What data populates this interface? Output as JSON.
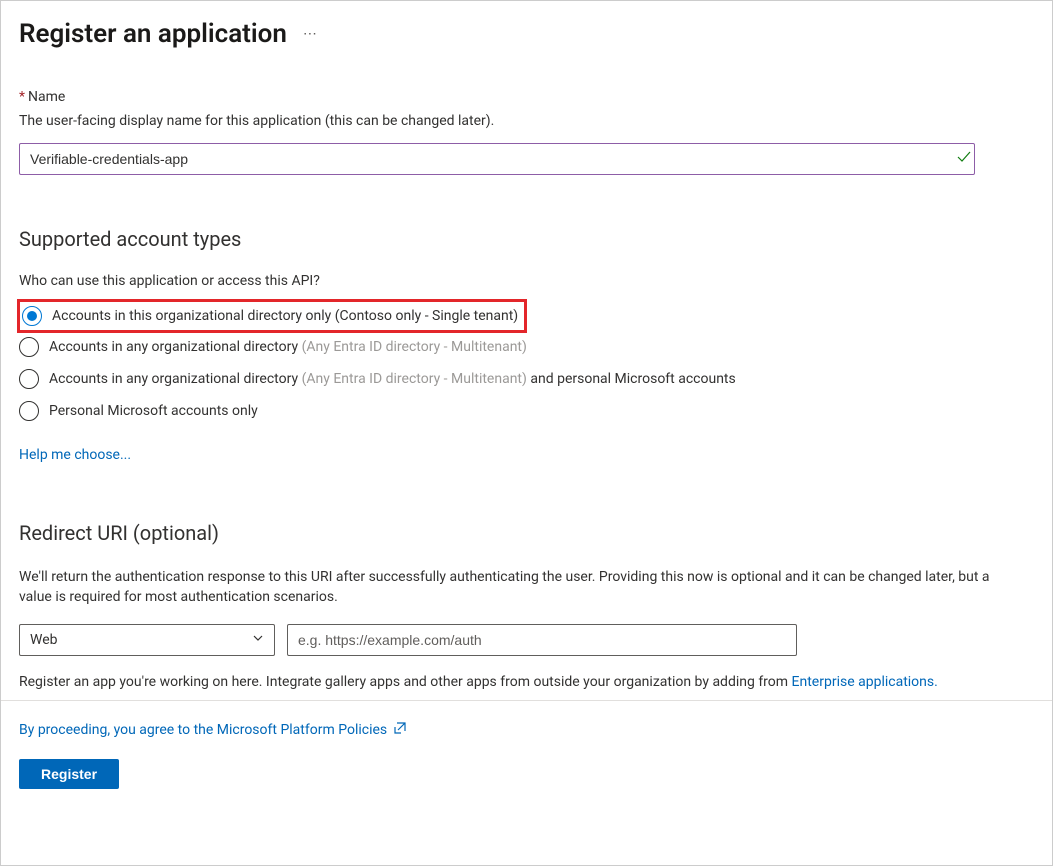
{
  "header": {
    "title": "Register an application"
  },
  "name_section": {
    "label": "Name",
    "description": "The user-facing display name for this application (this can be changed later).",
    "value": "Verifiable-credentials-app"
  },
  "account_types": {
    "title": "Supported account types",
    "question": "Who can use this application or access this API?",
    "options": [
      {
        "label": "Accounts in this organizational directory only (Contoso only - Single tenant)",
        "selected": true,
        "grey_suffix": ""
      },
      {
        "label": "Accounts in any organizational directory ",
        "grey_suffix": "(Any Entra ID directory - Multitenant)",
        "selected": false
      },
      {
        "label": "Accounts in any organizational directory ",
        "grey_suffix": "(Any Entra ID directory - Multitenant)",
        "extra_suffix": " and personal Microsoft accounts",
        "selected": false
      },
      {
        "label": "Personal Microsoft accounts only",
        "grey_suffix": "",
        "selected": false
      }
    ],
    "help_link": "Help me choose..."
  },
  "redirect": {
    "title": "Redirect URI (optional)",
    "description": "We'll return the authentication response to this URI after successfully authenticating the user. Providing this now is optional and it can be changed later, but a value is required for most authentication scenarios.",
    "platform_selected": "Web",
    "uri_placeholder": "e.g. https://example.com/auth"
  },
  "integrate_text": {
    "prefix": "Register an app you're working on here. Integrate gallery apps and other apps from outside your organization by adding from ",
    "link": "Enterprise applications."
  },
  "policies": {
    "text": "By proceeding, you agree to the Microsoft Platform Policies"
  },
  "register_button": "Register"
}
